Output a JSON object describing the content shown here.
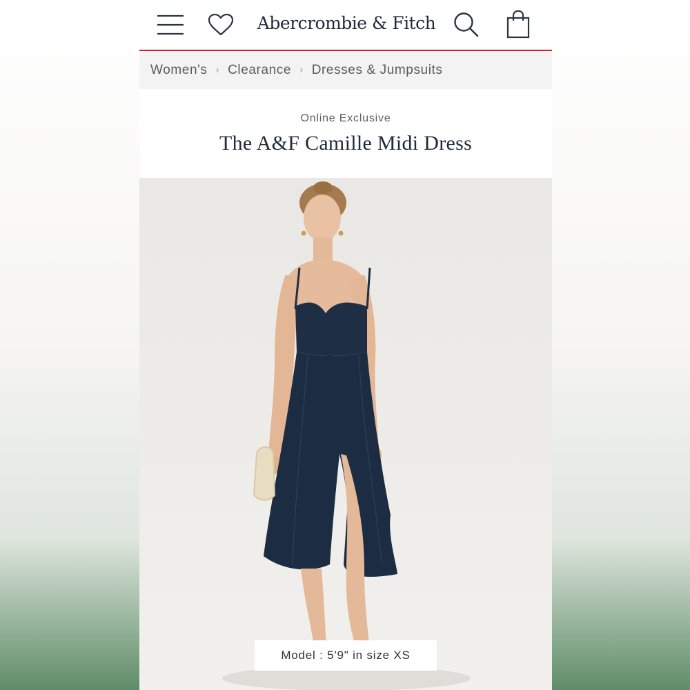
{
  "header": {
    "brand": "Abercrombie & Fitch",
    "icons": [
      "menu-icon",
      "heart-icon",
      "search-icon",
      "bag-icon"
    ],
    "accent_color": "#c8262f"
  },
  "breadcrumb": {
    "items": [
      {
        "label": "Women's"
      },
      {
        "label": "Clearance"
      },
      {
        "label": "Dresses & Jumpsuits"
      }
    ]
  },
  "product": {
    "tag": "Online Exclusive",
    "title": "The A&F Camille Midi Dress",
    "dress_color": "#1e2f45",
    "model_info": "Model : 5'9\" in size XS"
  }
}
